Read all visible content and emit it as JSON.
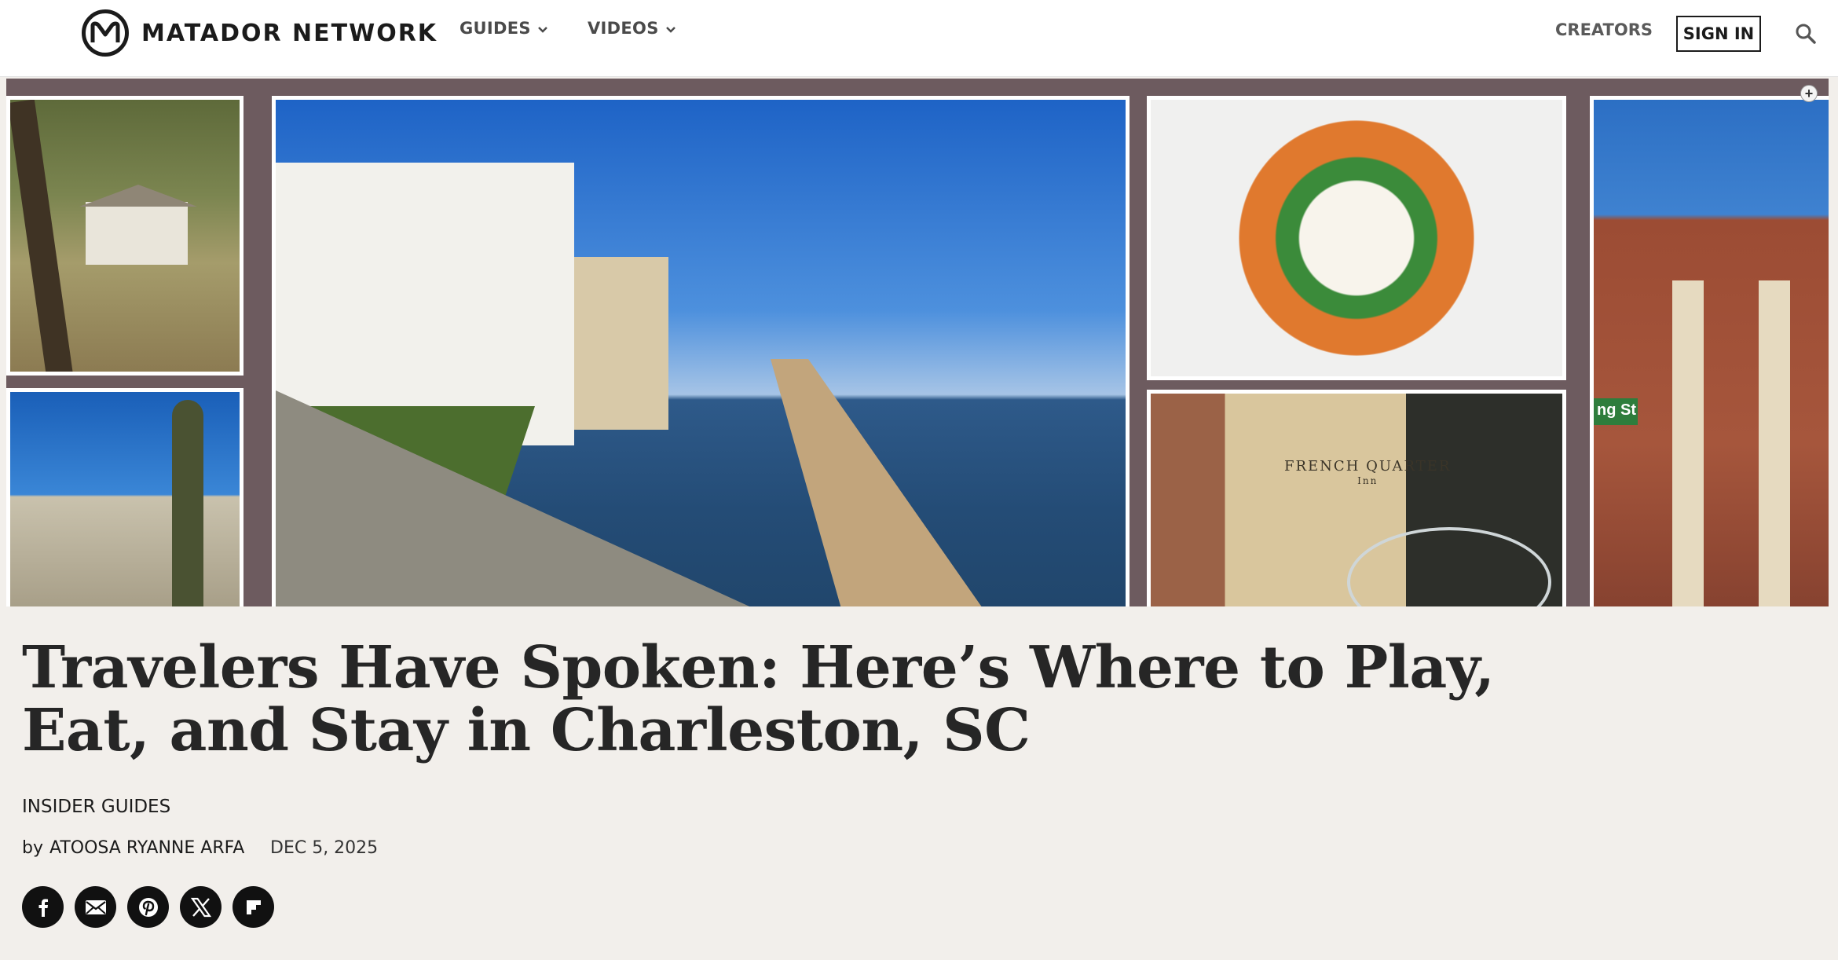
{
  "header": {
    "brand": "MATADOR NETWORK",
    "nav": [
      {
        "label": "GUIDES",
        "icon": "chevron-down-icon"
      },
      {
        "label": "VIDEOS",
        "icon": "chevron-down-icon"
      }
    ],
    "creators_label": "CREATORS",
    "signin_label": "SIGN IN",
    "search_icon": "search-icon"
  },
  "hero": {
    "hotel_sign": "FRENCH QUARTER",
    "hotel_sign_small": "Inn",
    "street_sign": "ng St",
    "expand_label": "+"
  },
  "article": {
    "title": "Travelers Have Spoken: Here’s Where to Play, Eat, and Stay in Charleston, SC",
    "category": "INSIDER GUIDES",
    "by_label": "by",
    "author": "ATOOSA RYANNE ARFA",
    "date": "DEC 5, 2025",
    "share_icons": [
      "facebook-icon",
      "email-icon",
      "pinterest-icon",
      "x-icon",
      "flipboard-icon"
    ]
  },
  "colors": {
    "header_bg": "#ffffff",
    "page_bg": "#f2efeb",
    "hero_frame": "#6d5b5f",
    "text": "#262626",
    "share_bg": "#111111"
  }
}
